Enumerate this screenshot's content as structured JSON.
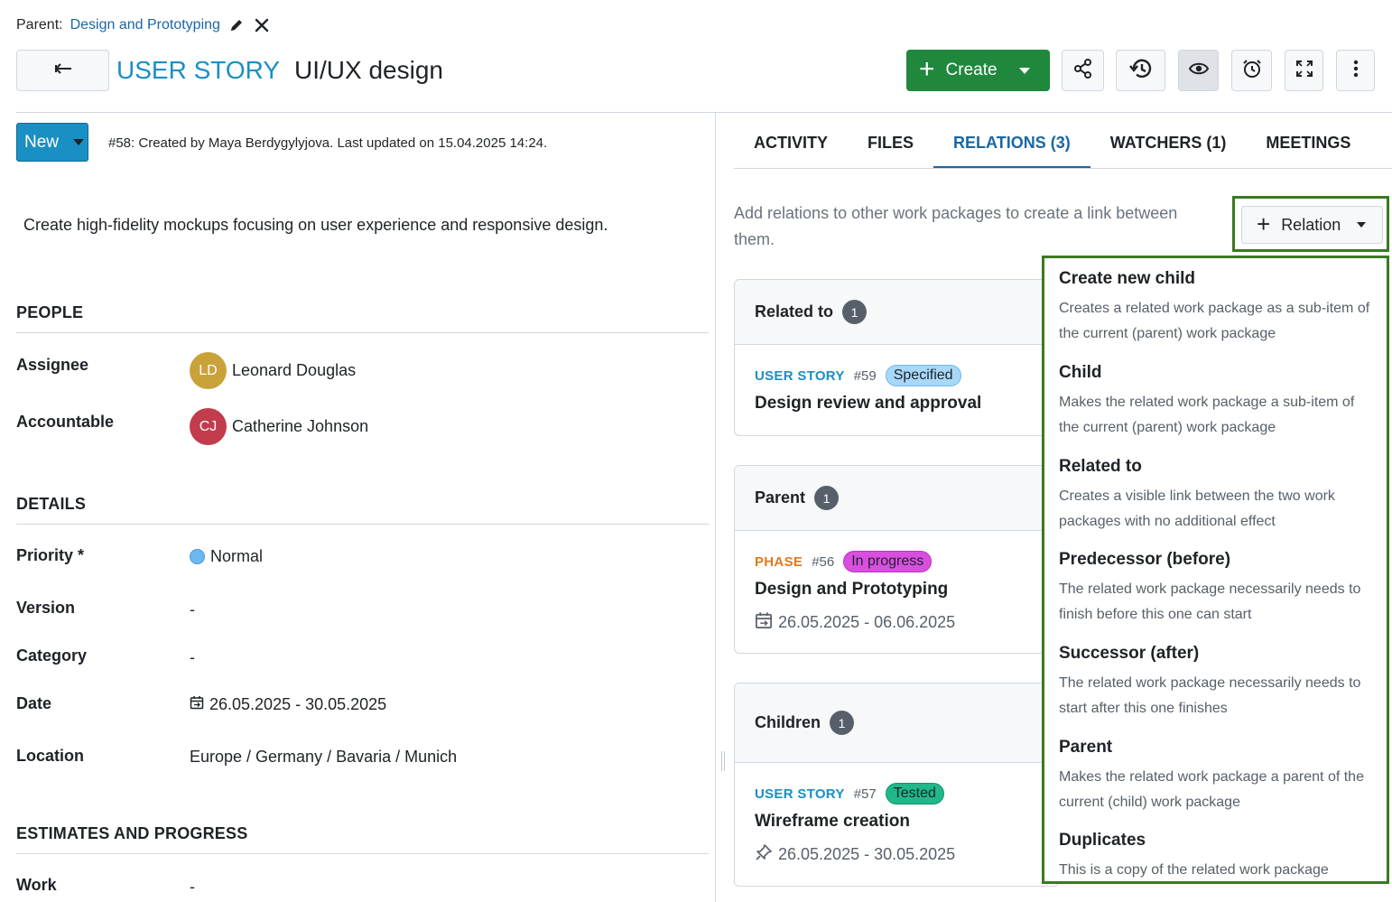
{
  "header": {
    "parent_label": "Parent:",
    "parent_link": "Design and Prototyping",
    "type": "USER STORY",
    "subject": "UI/UX design",
    "create_label": "Create"
  },
  "left": {
    "status": "New",
    "meta": "#58: Created by Maya Berdygylyjova. Last updated on 15.04.2025 14:24.",
    "description": "Create high-fidelity mockups focusing on user experience and responsive design.",
    "people": {
      "heading": "PEOPLE",
      "assignee_label": "Assignee",
      "assignee_initials": "LD",
      "assignee_name": "Leonard Douglas",
      "assignee_color": "#c9a23a",
      "accountable_label": "Accountable",
      "accountable_initials": "CJ",
      "accountable_name": "Catherine Johnson",
      "accountable_color": "#c23c4e"
    },
    "details": {
      "heading": "DETAILS",
      "priority_label": "Priority *",
      "priority_value": "Normal",
      "version_label": "Version",
      "version_value": "-",
      "category_label": "Category",
      "category_value": "-",
      "date_label": "Date",
      "date_value": "26.05.2025 - 30.05.2025",
      "location_label": "Location",
      "location_value": "Europe / Germany / Bavaria / Munich"
    },
    "estimates": {
      "heading": "ESTIMATES AND PROGRESS",
      "work_label": "Work",
      "work_value": "-"
    }
  },
  "tabs": [
    "ACTIVITY",
    "FILES",
    "RELATIONS (3)",
    "WATCHERS (1)",
    "MEETINGS"
  ],
  "relations": {
    "hint": "Add relations to other work packages to create a link between them.",
    "button_label": "Relation",
    "groups": [
      {
        "title": "Related to",
        "count": "1",
        "type": "USER STORY",
        "type_color": "#1a8fc4",
        "id": "#59",
        "status": "Specified",
        "status_bg": "#a8d8f8",
        "status_border": "#6db8f0",
        "subject": "Design review and approval",
        "date": ""
      },
      {
        "title": "Parent",
        "count": "1",
        "type": "PHASE",
        "type_color": "#e07a1f",
        "id": "#56",
        "status": "In progress",
        "status_bg": "#d84fe0",
        "status_border": "#b933c4",
        "subject": "Design and Prototyping",
        "date": "26.05.2025 - 06.06.2025"
      },
      {
        "title": "Children",
        "count": "1",
        "type": "USER STORY",
        "type_color": "#1a8fc4",
        "id": "#57",
        "status": "Tested",
        "status_bg": "#1fb88a",
        "status_border": "#15936d",
        "subject": "Wireframe creation",
        "date": "26.05.2025 - 30.05.2025"
      }
    ]
  },
  "dropdown": [
    {
      "title": "Create new child",
      "desc": "Creates a related work package as a sub-item of the current (parent) work package"
    },
    {
      "title": "Child",
      "desc": "Makes the related work package a sub-item of the current (parent) work package"
    },
    {
      "title": "Related to",
      "desc": "Creates a visible link between the two work packages with no additional effect"
    },
    {
      "title": "Predecessor (before)",
      "desc": "The related work package necessarily needs to finish before this one can start"
    },
    {
      "title": "Successor (after)",
      "desc": "The related work package necessarily needs to start after this one finishes"
    },
    {
      "title": "Parent",
      "desc": "Makes the related work package a parent of the current (child) work package"
    },
    {
      "title": "Duplicates",
      "desc": "This is a copy of the related work package"
    }
  ]
}
